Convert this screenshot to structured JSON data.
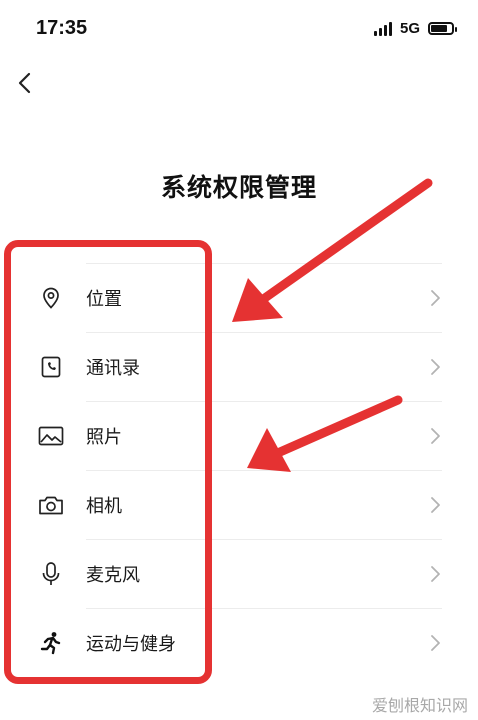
{
  "status_bar": {
    "time": "17:35",
    "network": "5G"
  },
  "page": {
    "title": "系统权限管理"
  },
  "items": [
    {
      "icon": "location-pin-icon",
      "label": "位置"
    },
    {
      "icon": "contacts-phone-icon",
      "label": "通讯录"
    },
    {
      "icon": "photo-icon",
      "label": "照片"
    },
    {
      "icon": "camera-icon",
      "label": "相机"
    },
    {
      "icon": "microphone-icon",
      "label": "麦克风"
    },
    {
      "icon": "running-person-icon",
      "label": "运动与健身"
    }
  ],
  "watermark": "爱刨根知识网",
  "colors": {
    "annotation": "#e53232",
    "divider": "#ececec",
    "chevron": "#b3b3b3"
  }
}
